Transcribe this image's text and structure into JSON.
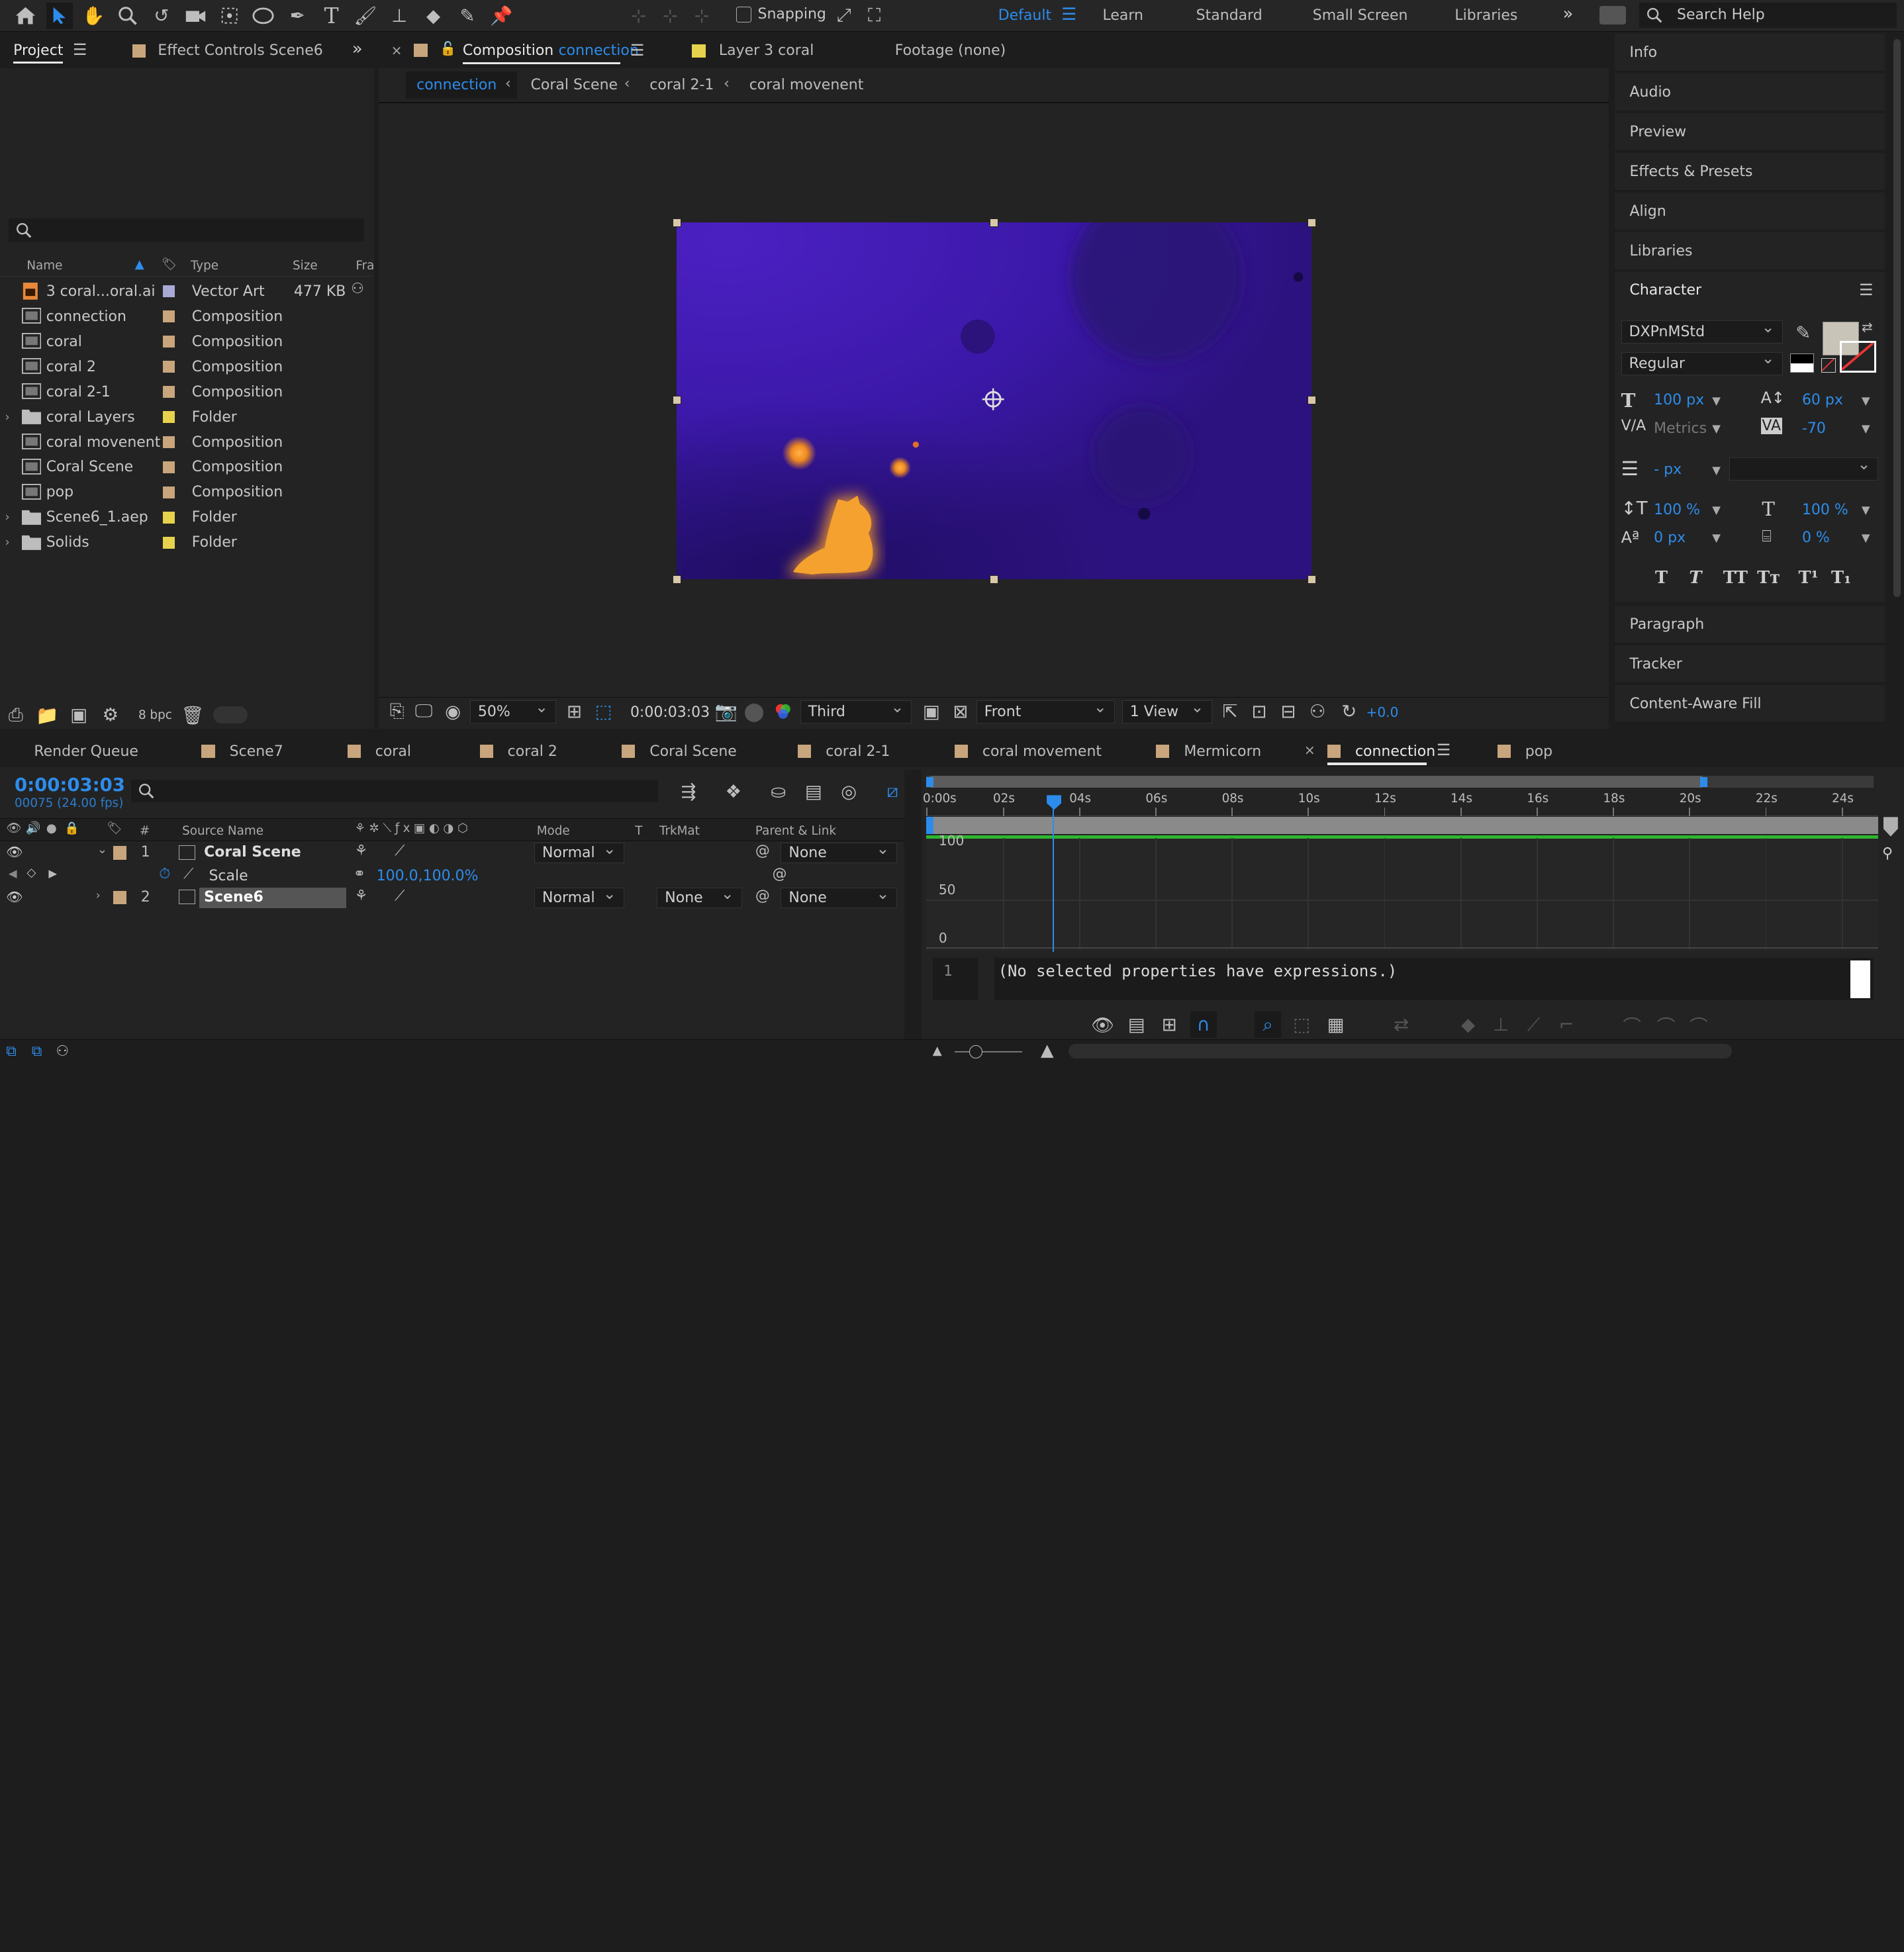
{
  "toolbar": {
    "snapping_label": "Snapping",
    "workspaces": [
      "Default",
      "Learn",
      "Standard",
      "Small Screen",
      "Libraries"
    ],
    "active_workspace": "Default",
    "search_placeholder": "Search Help"
  },
  "project_panel": {
    "tab_project": "Project",
    "tab_effect_controls": "Effect Controls Scene6",
    "columns": {
      "name": "Name",
      "type": "Type",
      "size": "Size",
      "frame": "Fra"
    },
    "items": [
      {
        "name": "3 coral...oral.ai",
        "type": "Vector Art",
        "size": "477 KB",
        "kind": "ai",
        "label_color": "#a9a9d6"
      },
      {
        "name": "connection",
        "type": "Composition",
        "size": "",
        "kind": "comp",
        "label_color": "#c8a57c"
      },
      {
        "name": "coral",
        "type": "Composition",
        "size": "",
        "kind": "comp",
        "label_color": "#c8a57c"
      },
      {
        "name": "coral 2",
        "type": "Composition",
        "size": "",
        "kind": "comp",
        "label_color": "#c8a57c"
      },
      {
        "name": "coral 2-1",
        "type": "Composition",
        "size": "",
        "kind": "comp",
        "label_color": "#c8a57c"
      },
      {
        "name": "coral Layers",
        "type": "Folder",
        "size": "",
        "kind": "folder",
        "label_color": "#e6d24c"
      },
      {
        "name": "coral movenent",
        "type": "Composition",
        "size": "",
        "kind": "comp",
        "label_color": "#c8a57c"
      },
      {
        "name": "Coral Scene",
        "type": "Composition",
        "size": "",
        "kind": "comp",
        "label_color": "#c8a57c"
      },
      {
        "name": "pop",
        "type": "Composition",
        "size": "",
        "kind": "comp",
        "label_color": "#c8a57c"
      },
      {
        "name": "Scene6_1.aep",
        "type": "Folder",
        "size": "",
        "kind": "folder",
        "label_color": "#e6d24c"
      },
      {
        "name": "Solids",
        "type": "Folder",
        "size": "",
        "kind": "folder",
        "label_color": "#e6d24c"
      }
    ],
    "bpc": "8 bpc"
  },
  "comp_panel": {
    "tab_prefix": "Composition",
    "tab_comp_name": "connection",
    "tab_layer": "Layer 3 coral",
    "tab_footage": "Footage (none)",
    "breadcrumbs": [
      "connection",
      "Coral Scene",
      "coral 2-1",
      "coral movenent"
    ],
    "zoom": "50%",
    "timecode": "0:00:03:03",
    "resolution": "Third",
    "view": "Front",
    "views_count": "1 View",
    "exposure": "+0.0"
  },
  "right_panels": {
    "top_items": [
      "Info",
      "Audio",
      "Preview",
      "Effects & Presets",
      "Align",
      "Libraries"
    ],
    "character": {
      "title": "Character",
      "font": "DXPnMStd",
      "style": "Regular",
      "size": "100 px",
      "leading": "60 px",
      "kerning": "Metrics",
      "tracking": "-70",
      "stroke": "- px",
      "vscale": "100 %",
      "hscale": "100 %",
      "baseline": "0 px",
      "tsume": "0 %",
      "fill_color": "#c9c4b8",
      "type_buttons": [
        "T",
        "T",
        "TT",
        "Tт",
        "T¹",
        "T₁"
      ]
    },
    "bottom_items": [
      "Paragraph",
      "Tracker",
      "Content-Aware Fill"
    ]
  },
  "timeline": {
    "tabs": [
      "Render Queue",
      "Scene7",
      "coral",
      "coral 2",
      "Coral Scene",
      "coral 2-1",
      "coral movement",
      "Mermicorn",
      "connection",
      "pop"
    ],
    "active_tab": "connection",
    "timecode": "0:00:03:03",
    "frames": "00075 (24.00 fps)",
    "columns": {
      "num": "#",
      "source": "Source Name",
      "mode": "Mode",
      "t": "T",
      "trkmat": "TrkMat",
      "parent": "Parent & Link"
    },
    "layers": [
      {
        "num": "1",
        "name": "Coral Scene",
        "mode": "Normal",
        "trkmat": "",
        "parent": "None"
      },
      {
        "num": "2",
        "name": "Scene6",
        "mode": "Normal",
        "trkmat": "None",
        "parent": "None"
      }
    ],
    "property": {
      "name": "Scale",
      "value": "100.0,100.0%"
    },
    "ruler_labels": [
      "0:00s",
      "02s",
      "04s",
      "06s",
      "08s",
      "10s",
      "12s",
      "14s",
      "16s",
      "18s",
      "20s",
      "22s",
      "24s"
    ],
    "graph_labels": [
      "100",
      "50",
      "0"
    ],
    "expression_line": "1",
    "expression_text": "(No selected properties have expressions.)"
  }
}
